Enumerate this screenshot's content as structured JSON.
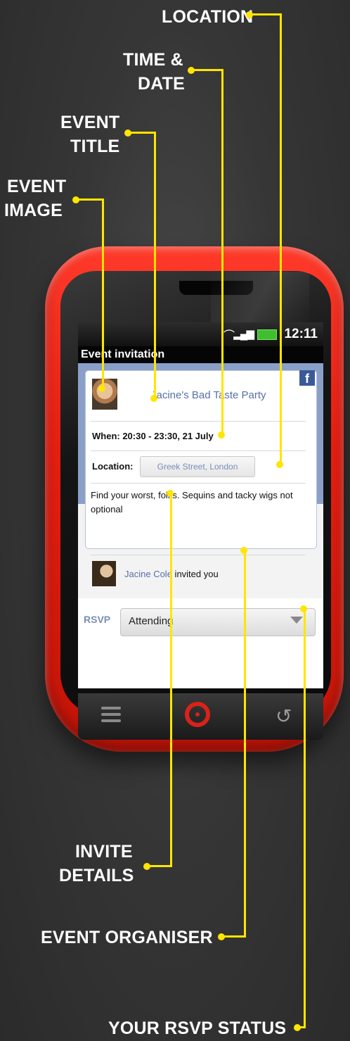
{
  "annotations": {
    "location": "LOCATION",
    "time_date_1": "TIME &",
    "time_date_2": "DATE",
    "event_title_1": "EVENT",
    "event_title_2": "TITLE",
    "event_image_1": "EVENT",
    "event_image_2": "IMAGE",
    "invite_details_1": "INVITE",
    "invite_details_2": "DETAILS",
    "event_organiser": "EVENT ORGANISER",
    "rsvp_status": "YOUR RSVP STATUS"
  },
  "phone": {
    "status_time": "12:11",
    "app_title": "Event invitation",
    "facebook_badge": "f",
    "event_title": "Jacine's Bad Taste Party",
    "when": "When: 20:30 - 23:30, 21 July",
    "location_label": "Location:",
    "location_value": "Greek Street, London",
    "details": "Find your worst, folks. Sequins and tacky wigs not optional",
    "organiser_name": "Jacine Cole",
    "organiser_suffix": " invited you",
    "rsvp_label": "RSVP",
    "rsvp_value": "Attending"
  },
  "colors": {
    "annotation_line": "#ffe500",
    "phone_body": "#e81f12",
    "link_blue": "#5a6fa8",
    "facebook_blue": "#3b5998"
  }
}
